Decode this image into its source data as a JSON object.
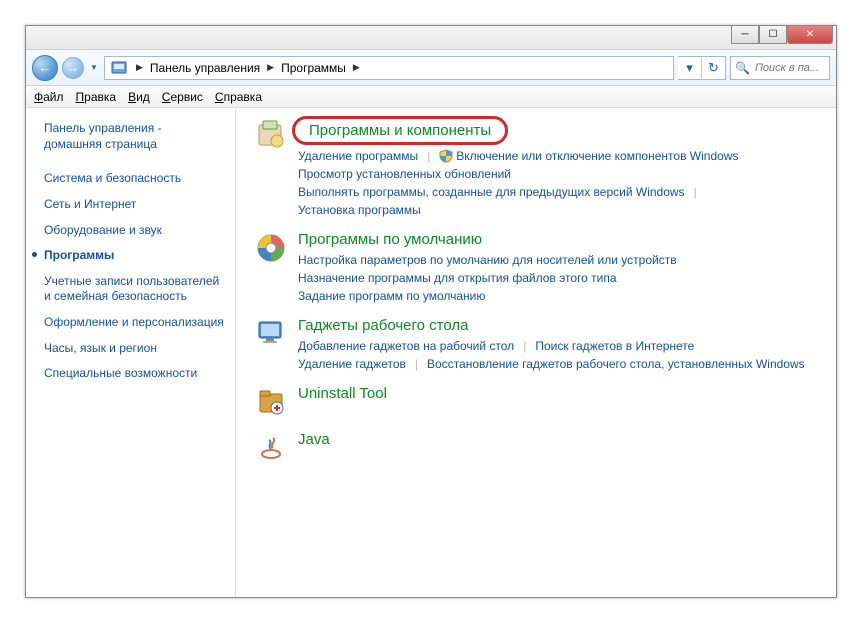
{
  "titlebar": {
    "min": "_",
    "max": "□",
    "close": "✕"
  },
  "nav": {
    "back": "←",
    "forward": "→"
  },
  "breadcrumb": {
    "root": "Панель управления",
    "current": "Программы",
    "sep": "▶"
  },
  "refresh": "↻",
  "search": {
    "placeholder": "Поиск в па...",
    "icon": "🔍"
  },
  "menu": {
    "file": "Файл",
    "edit": "Правка",
    "view": "Вид",
    "service": "Сервис",
    "help": "Справка",
    "file_u": "Ф",
    "edit_u": "П",
    "view_u": "В",
    "service_u": "С",
    "help_u": "С"
  },
  "sidebar": {
    "home_l1": "Панель управления -",
    "home_l2": "домашняя страница",
    "items": [
      {
        "label": "Система и безопасность"
      },
      {
        "label": "Сеть и Интернет"
      },
      {
        "label": "Оборудование и звук"
      },
      {
        "label": "Программы"
      },
      {
        "label": "Учетные записи пользователей и семейная безопасность"
      },
      {
        "label": "Оформление и персонализация"
      },
      {
        "label": "Часы, язык и регион"
      },
      {
        "label": "Специальные возможности"
      }
    ]
  },
  "sections": [
    {
      "title": "Программы и компоненты",
      "highlighted": true,
      "rows": [
        [
          {
            "t": "Удаление программы"
          },
          {
            "sep": true
          },
          {
            "shield": true,
            "t": "Включение или отключение компонентов Windows"
          }
        ],
        [
          {
            "t": "Просмотр установленных обновлений"
          }
        ],
        [
          {
            "t": "Выполнять программы, созданные для предыдущих версий Windows"
          },
          {
            "sep": true
          },
          {
            "t": "Установка программы"
          }
        ]
      ]
    },
    {
      "title": "Программы по умолчанию",
      "rows": [
        [
          {
            "t": "Настройка параметров по умолчанию для носителей или устройств"
          }
        ],
        [
          {
            "t": "Назначение программы для открытия файлов этого типа"
          }
        ],
        [
          {
            "t": "Задание программ по умолчанию"
          }
        ]
      ]
    },
    {
      "title": "Гаджеты рабочего стола",
      "rows": [
        [
          {
            "t": "Добавление гаджетов на рабочий стол"
          },
          {
            "sep": true
          },
          {
            "t": "Поиск гаджетов в Интернете"
          }
        ],
        [
          {
            "t": "Удаление гаджетов"
          },
          {
            "sep": true
          },
          {
            "t": "Восстановление гаджетов рабочего стола, установленных Windows"
          }
        ]
      ]
    },
    {
      "title": "Uninstall Tool",
      "rows": []
    },
    {
      "title": "Java",
      "rows": []
    }
  ]
}
